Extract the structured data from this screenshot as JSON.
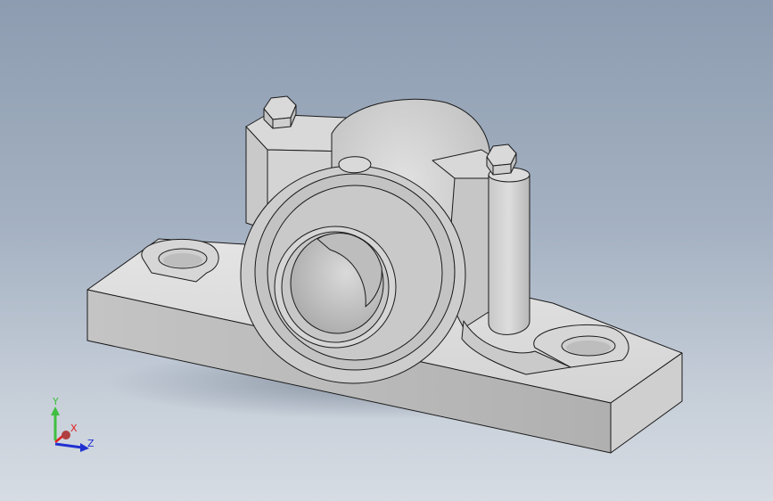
{
  "viewport": {
    "background_top": "#8d9cb0",
    "background_bottom": "#d6dce3"
  },
  "model": {
    "name": "plummer-block-bearing-housing",
    "body_color": "#d2d2d2",
    "edge_color": "#1a1a1a"
  },
  "triad": {
    "y_label": "Y",
    "x_label": "X",
    "z_label": "Z",
    "y_color": "#3fbf3f",
    "x_color": "#e02020",
    "z_color": "#2030d0"
  }
}
